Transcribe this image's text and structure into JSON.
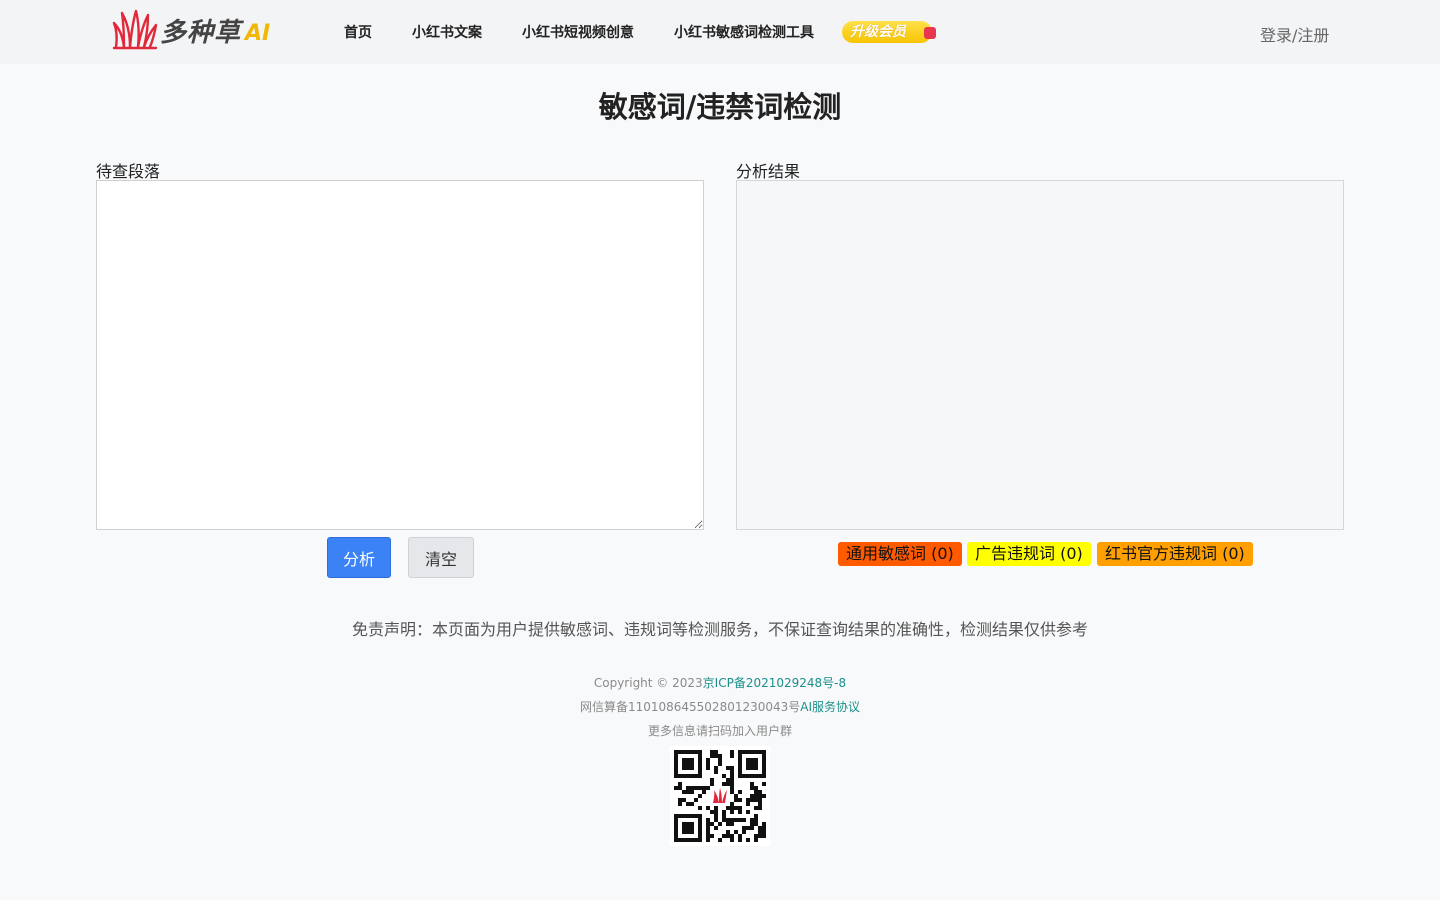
{
  "header": {
    "logo_text": "多种草",
    "logo_ai": "AI",
    "nav": [
      {
        "label": "首页"
      },
      {
        "label": "小红书文案"
      },
      {
        "label": "小红书短视频创意"
      },
      {
        "label": "小红书敏感词检测工具"
      }
    ],
    "vip_label": "升级会员",
    "login_label": "登录/注册"
  },
  "main": {
    "title": "敏感词/违禁词检测",
    "input_label": "待查段落",
    "input_value": "",
    "result_label": "分析结果",
    "analyze_button": "分析",
    "clear_button": "清空",
    "tags": [
      {
        "label": "通用敏感词 (0)",
        "color": "#ff5a00"
      },
      {
        "label": "广告违规词 (0)",
        "color": "#ffff00"
      },
      {
        "label": "红书官方违规词 (0)",
        "color": "#ffa000"
      }
    ],
    "disclaimer": "免责声明：本页面为用户提供敏感词、违规词等检测服务，不保证查询结果的准确性，检测结果仅供参考"
  },
  "footer": {
    "copyright": "Copyright © 2023",
    "icp_link": "京ICP备2021029248号-8",
    "algo_record": "网信算备110108645502801230043号",
    "service_link": "AI服务协议",
    "qr_hint": "更多信息请扫码加入用户群"
  },
  "colors": {
    "accent_blue": "#3b82f6",
    "link_teal": "#1b8f8a",
    "vip_yellow": "#f7c400",
    "logo_red": "#e02a3c"
  }
}
